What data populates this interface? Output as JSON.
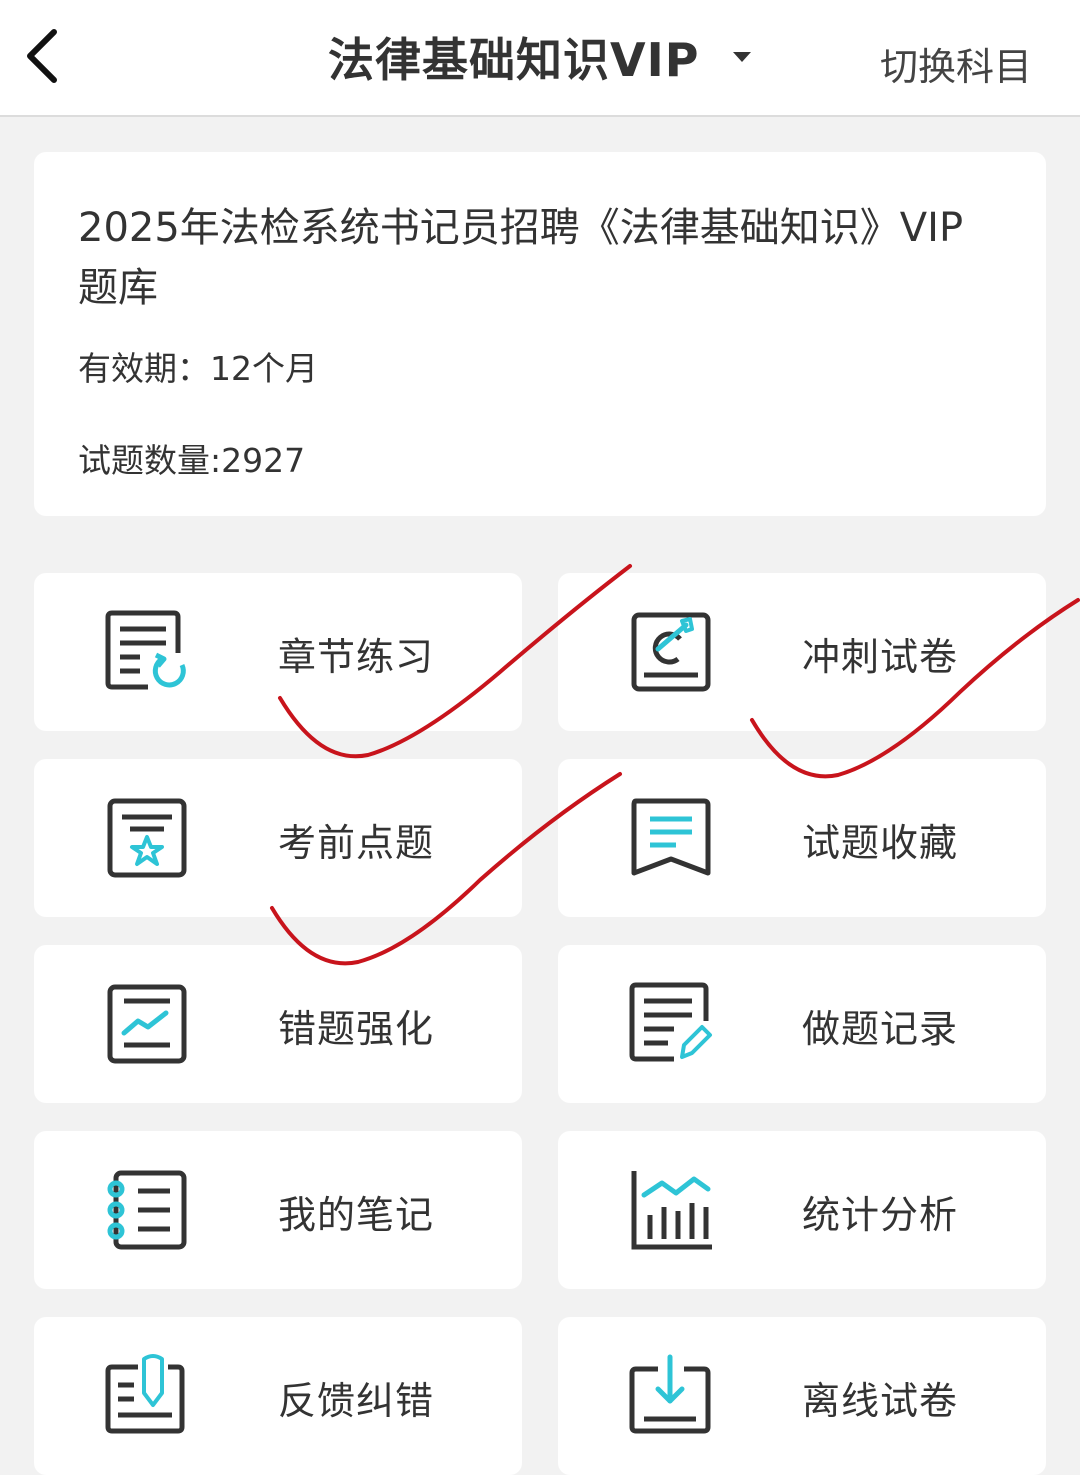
{
  "header": {
    "title": "法律基础知识VIP",
    "switch_label": "切换科目"
  },
  "info": {
    "title": "2025年法检系统书记员招聘《法律基础知识》VIP题库",
    "validity": "有效期：12个月",
    "count": "试题数量:2927"
  },
  "tiles": [
    {
      "label": "章节练习",
      "icon": "chapter-practice-icon"
    },
    {
      "label": "冲刺试卷",
      "icon": "sprint-paper-icon"
    },
    {
      "label": "考前点题",
      "icon": "pre-exam-tips-icon"
    },
    {
      "label": "试题收藏",
      "icon": "favorites-icon"
    },
    {
      "label": "错题强化",
      "icon": "wrong-questions-icon"
    },
    {
      "label": "做题记录",
      "icon": "practice-record-icon"
    },
    {
      "label": "我的笔记",
      "icon": "notes-icon"
    },
    {
      "label": "统计分析",
      "icon": "statistics-icon"
    },
    {
      "label": "反馈纠错",
      "icon": "feedback-icon"
    },
    {
      "label": "离线试卷",
      "icon": "offline-paper-icon"
    }
  ],
  "colors": {
    "accent": "#2ec4d6",
    "icon_stroke": "#333333",
    "checkmark": "#c8141c",
    "background": "#f2f2f2"
  }
}
